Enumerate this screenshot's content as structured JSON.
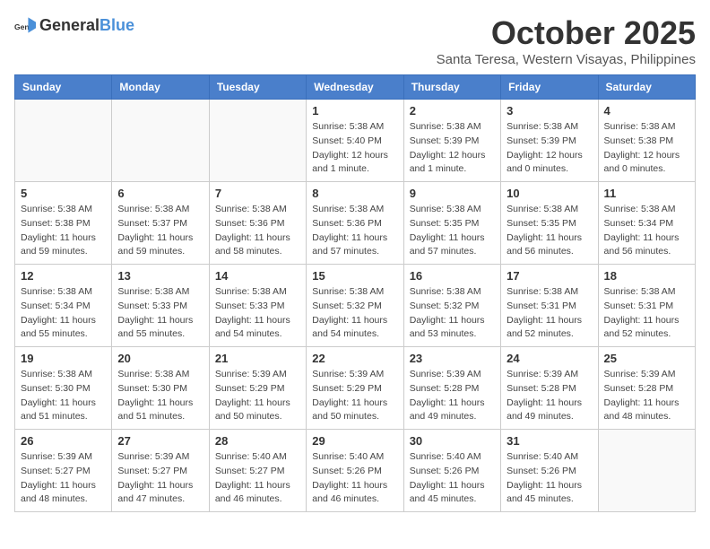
{
  "header": {
    "logo_general": "General",
    "logo_blue": "Blue",
    "month": "October 2025",
    "location": "Santa Teresa, Western Visayas, Philippines"
  },
  "days_of_week": [
    "Sunday",
    "Monday",
    "Tuesday",
    "Wednesday",
    "Thursday",
    "Friday",
    "Saturday"
  ],
  "weeks": [
    [
      {
        "day": "",
        "info": ""
      },
      {
        "day": "",
        "info": ""
      },
      {
        "day": "",
        "info": ""
      },
      {
        "day": "1",
        "info": "Sunrise: 5:38 AM\nSunset: 5:40 PM\nDaylight: 12 hours\nand 1 minute."
      },
      {
        "day": "2",
        "info": "Sunrise: 5:38 AM\nSunset: 5:39 PM\nDaylight: 12 hours\nand 1 minute."
      },
      {
        "day": "3",
        "info": "Sunrise: 5:38 AM\nSunset: 5:39 PM\nDaylight: 12 hours\nand 0 minutes."
      },
      {
        "day": "4",
        "info": "Sunrise: 5:38 AM\nSunset: 5:38 PM\nDaylight: 12 hours\nand 0 minutes."
      }
    ],
    [
      {
        "day": "5",
        "info": "Sunrise: 5:38 AM\nSunset: 5:38 PM\nDaylight: 11 hours\nand 59 minutes."
      },
      {
        "day": "6",
        "info": "Sunrise: 5:38 AM\nSunset: 5:37 PM\nDaylight: 11 hours\nand 59 minutes."
      },
      {
        "day": "7",
        "info": "Sunrise: 5:38 AM\nSunset: 5:36 PM\nDaylight: 11 hours\nand 58 minutes."
      },
      {
        "day": "8",
        "info": "Sunrise: 5:38 AM\nSunset: 5:36 PM\nDaylight: 11 hours\nand 57 minutes."
      },
      {
        "day": "9",
        "info": "Sunrise: 5:38 AM\nSunset: 5:35 PM\nDaylight: 11 hours\nand 57 minutes."
      },
      {
        "day": "10",
        "info": "Sunrise: 5:38 AM\nSunset: 5:35 PM\nDaylight: 11 hours\nand 56 minutes."
      },
      {
        "day": "11",
        "info": "Sunrise: 5:38 AM\nSunset: 5:34 PM\nDaylight: 11 hours\nand 56 minutes."
      }
    ],
    [
      {
        "day": "12",
        "info": "Sunrise: 5:38 AM\nSunset: 5:34 PM\nDaylight: 11 hours\nand 55 minutes."
      },
      {
        "day": "13",
        "info": "Sunrise: 5:38 AM\nSunset: 5:33 PM\nDaylight: 11 hours\nand 55 minutes."
      },
      {
        "day": "14",
        "info": "Sunrise: 5:38 AM\nSunset: 5:33 PM\nDaylight: 11 hours\nand 54 minutes."
      },
      {
        "day": "15",
        "info": "Sunrise: 5:38 AM\nSunset: 5:32 PM\nDaylight: 11 hours\nand 54 minutes."
      },
      {
        "day": "16",
        "info": "Sunrise: 5:38 AM\nSunset: 5:32 PM\nDaylight: 11 hours\nand 53 minutes."
      },
      {
        "day": "17",
        "info": "Sunrise: 5:38 AM\nSunset: 5:31 PM\nDaylight: 11 hours\nand 52 minutes."
      },
      {
        "day": "18",
        "info": "Sunrise: 5:38 AM\nSunset: 5:31 PM\nDaylight: 11 hours\nand 52 minutes."
      }
    ],
    [
      {
        "day": "19",
        "info": "Sunrise: 5:38 AM\nSunset: 5:30 PM\nDaylight: 11 hours\nand 51 minutes."
      },
      {
        "day": "20",
        "info": "Sunrise: 5:38 AM\nSunset: 5:30 PM\nDaylight: 11 hours\nand 51 minutes."
      },
      {
        "day": "21",
        "info": "Sunrise: 5:39 AM\nSunset: 5:29 PM\nDaylight: 11 hours\nand 50 minutes."
      },
      {
        "day": "22",
        "info": "Sunrise: 5:39 AM\nSunset: 5:29 PM\nDaylight: 11 hours\nand 50 minutes."
      },
      {
        "day": "23",
        "info": "Sunrise: 5:39 AM\nSunset: 5:28 PM\nDaylight: 11 hours\nand 49 minutes."
      },
      {
        "day": "24",
        "info": "Sunrise: 5:39 AM\nSunset: 5:28 PM\nDaylight: 11 hours\nand 49 minutes."
      },
      {
        "day": "25",
        "info": "Sunrise: 5:39 AM\nSunset: 5:28 PM\nDaylight: 11 hours\nand 48 minutes."
      }
    ],
    [
      {
        "day": "26",
        "info": "Sunrise: 5:39 AM\nSunset: 5:27 PM\nDaylight: 11 hours\nand 48 minutes."
      },
      {
        "day": "27",
        "info": "Sunrise: 5:39 AM\nSunset: 5:27 PM\nDaylight: 11 hours\nand 47 minutes."
      },
      {
        "day": "28",
        "info": "Sunrise: 5:40 AM\nSunset: 5:27 PM\nDaylight: 11 hours\nand 46 minutes."
      },
      {
        "day": "29",
        "info": "Sunrise: 5:40 AM\nSunset: 5:26 PM\nDaylight: 11 hours\nand 46 minutes."
      },
      {
        "day": "30",
        "info": "Sunrise: 5:40 AM\nSunset: 5:26 PM\nDaylight: 11 hours\nand 45 minutes."
      },
      {
        "day": "31",
        "info": "Sunrise: 5:40 AM\nSunset: 5:26 PM\nDaylight: 11 hours\nand 45 minutes."
      },
      {
        "day": "",
        "info": ""
      }
    ]
  ]
}
